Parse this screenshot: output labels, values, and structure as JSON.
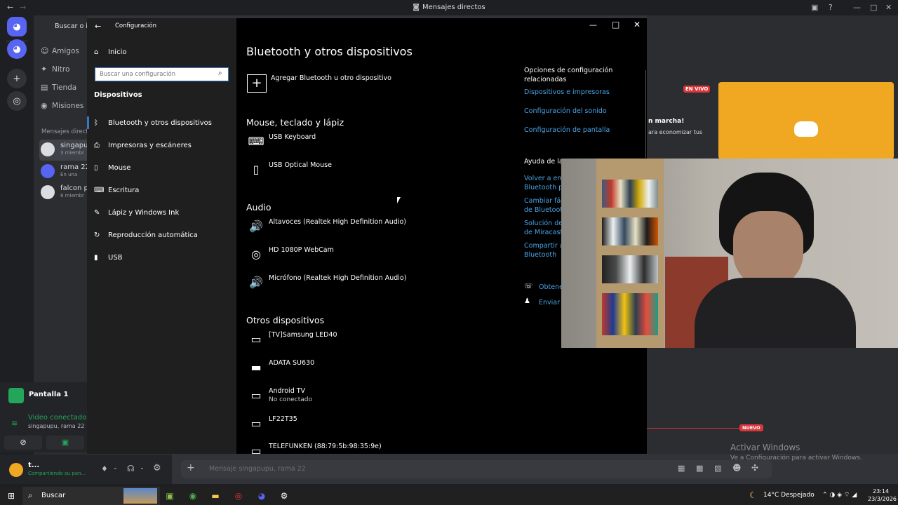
{
  "discord": {
    "window_title": "Mensajes directos",
    "search_label": "Buscar o i",
    "nav": [
      {
        "label": "Amigos",
        "icon": "friends-icon",
        "glyph": "☺"
      },
      {
        "label": "Nitro",
        "icon": "nitro-icon",
        "glyph": "✦"
      },
      {
        "label": "Tienda",
        "icon": "shop-icon",
        "glyph": "▤"
      },
      {
        "label": "Misiones",
        "icon": "quests-icon",
        "glyph": "◉"
      }
    ],
    "dm_header": "Mensajes direct",
    "dms": [
      {
        "name": "singapu",
        "sub": "3 miembr"
      },
      {
        "name": "rama 22",
        "sub": "En una"
      },
      {
        "name": "falcon p",
        "sub": "8 miembr"
      }
    ],
    "voice": {
      "screen_label": "Pantalla 1",
      "status": "Video conectado",
      "channel": "singapupu, rama 22"
    },
    "user": {
      "name": "t...",
      "status": "Compartiendo su pan..."
    },
    "composer_placeholder": "Mensaje singapupu, rama 22",
    "stream": {
      "live_badge": "EN VIVO",
      "promo_title": "n marcha!",
      "promo_sub": "ara economizar tus",
      "new_badge": "NUEVO"
    },
    "activate": {
      "title": "Activar Windows",
      "sub": "Ve a Configuración para activar Windows."
    },
    "colors": {
      "brand": "#5865f2",
      "stream_tile": "#f0a823",
      "live": "#da373c",
      "green": "#23a55a"
    }
  },
  "settings": {
    "app_title": "Configuración",
    "home_label": "Inicio",
    "search_placeholder": "Buscar una configuración",
    "section_label": "Dispositivos",
    "sidebar_items": [
      {
        "label": "Bluetooth y otros dispositivos",
        "icon": "bluetooth-icon",
        "glyph": "ᛒ"
      },
      {
        "label": "Impresoras y escáneres",
        "icon": "printer-icon",
        "glyph": "⎙"
      },
      {
        "label": "Mouse",
        "icon": "mouse-icon",
        "glyph": "▯"
      },
      {
        "label": "Escritura",
        "icon": "keyboard-icon",
        "glyph": "⌨"
      },
      {
        "label": "Lápiz y Windows Ink",
        "icon": "pen-icon",
        "glyph": "✎"
      },
      {
        "label": "Reproducción automática",
        "icon": "autoplay-icon",
        "glyph": "↻"
      },
      {
        "label": "USB",
        "icon": "usb-icon",
        "glyph": "▮"
      }
    ],
    "page_title": "Bluetooth y otros dispositivos",
    "add_device_label": "Agregar Bluetooth u otro dispositivo",
    "groups": [
      {
        "title": "Mouse, teclado y lápiz",
        "devices": [
          {
            "name": "USB Keyboard",
            "status": "",
            "icon": "keyboard-icon",
            "glyph": "⌨"
          },
          {
            "name": "USB Optical Mouse",
            "status": "",
            "icon": "mouse-icon",
            "glyph": "▯"
          }
        ]
      },
      {
        "title": "Audio",
        "devices": [
          {
            "name": "Altavoces (Realtek High Definition Audio)",
            "status": "",
            "icon": "speaker-icon",
            "glyph": "🔊"
          },
          {
            "name": "HD 1080P WebCam",
            "status": "",
            "icon": "webcam-icon",
            "glyph": "◎"
          },
          {
            "name": "Micrófono (Realtek High Definition Audio)",
            "status": "",
            "icon": "speaker-icon",
            "glyph": "🔊"
          }
        ]
      },
      {
        "title": "Otros dispositivos",
        "devices": [
          {
            "name": "[TV]Samsung LED40",
            "status": "",
            "icon": "display-device-icon",
            "glyph": "▭"
          },
          {
            "name": "ADATA SU630",
            "status": "",
            "icon": "drive-icon",
            "glyph": "▬"
          },
          {
            "name": "Android TV",
            "status": "No conectado",
            "icon": "display-device-icon",
            "glyph": "▭"
          },
          {
            "name": "LF22T35",
            "status": "",
            "icon": "monitor-icon",
            "glyph": "▭"
          },
          {
            "name": "TELEFUNKEN (88:79:5b:98:35:9e)",
            "status": "",
            "icon": "display-device-icon",
            "glyph": "▭"
          }
        ]
      }
    ],
    "related_title": "Opciones de configuración relacionadas",
    "related_links": [
      "Dispositivos e impresoras",
      "Configuración del sonido",
      "Configuración de pantalla"
    ],
    "help_title": "Ayuda de la",
    "help_links": [
      "Volver a em",
      "Bluetooth p",
      "Cambiar fác",
      "de Bluetoot",
      "Solución de",
      "de Miracast",
      "Compartir a",
      "Bluetooth"
    ],
    "footer_links": [
      "Obtene",
      "Enviar c"
    ]
  },
  "taskbar": {
    "search_label": "Buscar",
    "weather": "14°C  Despejado",
    "time": "23:14",
    "date": "23/3/2026"
  }
}
